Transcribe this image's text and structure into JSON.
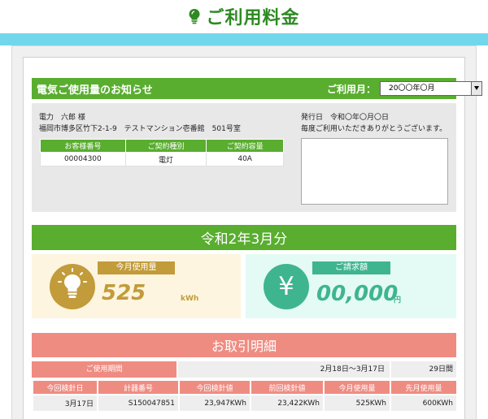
{
  "header": {
    "title": "ご利用料金"
  },
  "notice": {
    "title": "電気ご使用量のお知らせ",
    "period_label": "ご利用月：",
    "period_value": "20〇〇年〇月"
  },
  "customer": {
    "name": "電力　六郎 様",
    "address": "福岡市博多区竹下2-1-9　テストマンション壱番館　501号室",
    "contract_headers": [
      "お客様番号",
      "ご契約種別",
      "ご契約容量"
    ],
    "contract_values": [
      "00004300",
      "電灯",
      "40A"
    ],
    "issue_date": "発行日　令和〇年〇月〇日",
    "thanks": "毎度ご利用いただきありがとうございます。"
  },
  "month_title": "令和2年3月分",
  "usage": {
    "label": "今月使用量",
    "value": "525",
    "unit": "kWh"
  },
  "billing": {
    "label": "ご請求額",
    "symbol": "¥",
    "value": "00,000",
    "unit": "円"
  },
  "transactions": {
    "title": "お取引明細",
    "period_label": "ご使用期間",
    "period_range": "2月18日～3月17日",
    "period_days": "29日間",
    "headers": [
      "今回検針日",
      "計器番号",
      "今回検針値",
      "前回検針値",
      "今月使用量",
      "先月使用量"
    ],
    "row": [
      "3月17日",
      "S150047851",
      "23,947KWh",
      "23,422KWh",
      "525KWh",
      "600KWh"
    ]
  },
  "colors": {
    "green": "#59ad2f",
    "header_green": "#2e8b22",
    "cyan": "#73d7ec",
    "gold": "#c29b3a",
    "teal": "#3fb58f",
    "salmon": "#ef8c82"
  }
}
